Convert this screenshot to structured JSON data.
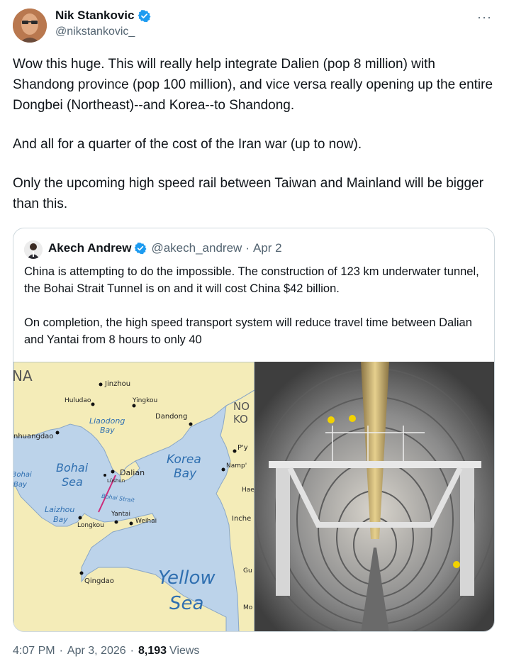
{
  "author": {
    "name": "Nik Stankovic",
    "handle": "@nikstankovic_",
    "more": "···"
  },
  "tweet": {
    "paragraphs": [
      "Wow this huge. This will really help integrate Dalien (pop 8 million) with Shandong province (pop 100 million), and vice versa really opening up the entire Dongbei (Northeast)--and Korea--to Shandong.",
      "And all for a quarter of the cost of the Iran war (up to now).",
      "Only the upcoming high speed rail between Taiwan and Mainland will be bigger than this."
    ]
  },
  "quote": {
    "name": "Akech Andrew",
    "handle": "@akech_andrew",
    "dot": "·",
    "date": "Apr 2",
    "paragraphs": [
      "China is attempting to do the impossible. The construction of 123 km underwater tunnel, the Bohai Strait Tunnel is on and it will cost China $42 billion.",
      "On completion, the high speed transport system will reduce travel time between Dalian and Yantai from 8 hours to only 40"
    ],
    "map_labels": {
      "na": "NA",
      "jinzhou": "Jinzhou",
      "huludao": "Huludao",
      "yingkou": "Yingkou",
      "liaodong": "Liaodong",
      "bay1": "Bay",
      "dandong": "Dandong",
      "no": "NO",
      "ko": "KO",
      "qinhuangdao": "nhuangdao",
      "bohai1": "Bohai",
      "sea1": "Sea",
      "dalian": "Dalian",
      "lushun": "Lüshun",
      "korea": "Korea",
      "bay2": "Bay",
      "py": "P'y",
      "namp": "Namp'",
      "bohai_left": "3ohai",
      "bay_left": "Bay",
      "bohai_strait": "Bohai Strait",
      "haej": "Haej",
      "laizhou": "Laizhou",
      "bay3": "Bay",
      "yantai": "Yantai",
      "weihai": "Weihai",
      "longkou": "Longkou",
      "inche": "Inche",
      "qingdao": "Qingdao",
      "yellow": "Yellow",
      "sea2": "Sea",
      "gu": "Gu",
      "mo": "Mo"
    }
  },
  "footer": {
    "time": "4:07 PM",
    "sep1": "·",
    "date": "Apr 3, 2026",
    "sep2": "·",
    "views_count": "8,193",
    "views_label": "Views"
  },
  "colors": {
    "verified": "#1d9bf0",
    "map_sea": "#bcd3ea",
    "map_land": "#f4ecb8",
    "tunnel_line": "#cc2b7a"
  }
}
